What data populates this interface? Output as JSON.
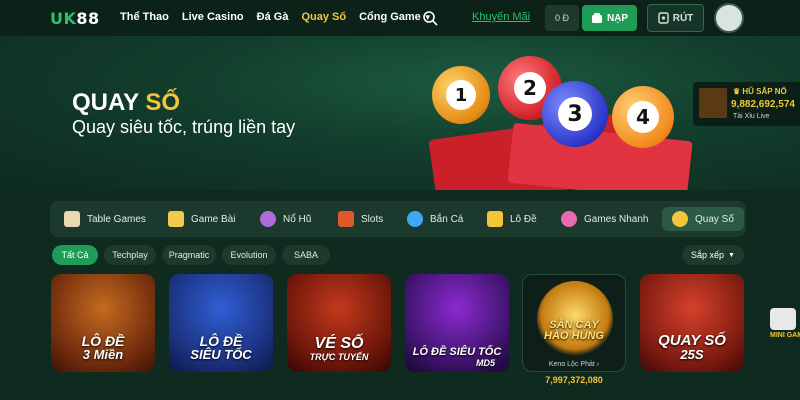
{
  "brand": {
    "logo_a": "UK",
    "logo_b": "88"
  },
  "nav": {
    "items": [
      "Thể Thao",
      "Live Casino",
      "Đá Gà",
      "Quay Số",
      "Cổng Game"
    ],
    "active": "Quay Số"
  },
  "header": {
    "promo": "Khuyến Mãi",
    "balance": "0 Đ",
    "deposit_label": "NẠP",
    "withdraw_label": "RÚT"
  },
  "banner": {
    "title_white": "QUAY",
    "title_yellow": "SỐ",
    "subtitle": "Quay siêu tốc, trúng liền tay",
    "balls": [
      "1",
      "2",
      "3",
      "4"
    ]
  },
  "jackpot": {
    "title": "HŨ SẮP NỔ",
    "value": "9,882,692,574",
    "game": "Tài Xỉu Live"
  },
  "categories": [
    {
      "label": "Table Games",
      "icon": "dice-icon"
    },
    {
      "label": "Game Bài",
      "icon": "cards-icon"
    },
    {
      "label": "Nổ Hũ",
      "icon": "pot-icon"
    },
    {
      "label": "Slots",
      "icon": "seven-icon"
    },
    {
      "label": "Bắn Cá",
      "icon": "fish-icon"
    },
    {
      "label": "Lô Đề",
      "icon": "ticket-icon"
    },
    {
      "label": "Games Nhanh",
      "icon": "rocket-icon"
    },
    {
      "label": "Quay Số",
      "icon": "lottery-ball-icon"
    }
  ],
  "filters": [
    "Tất Cả",
    "Techplay",
    "Pragmatic",
    "Evolution",
    "SABA"
  ],
  "sort_label": "Sắp xếp",
  "games": [
    {
      "line1": "LÔ ĐỀ",
      "line2": "3 Miền"
    },
    {
      "line1": "LÔ ĐỀ",
      "line2": "SIÊU TỐC"
    },
    {
      "line1": "VÉ SỐ",
      "line2": "TRỰC TUYẾN"
    },
    {
      "line1": "LÔ ĐỀ SIÊU TỐC",
      "line2": "MD5"
    },
    {
      "line1": "SĂN CÁY",
      "line2": "HÀO HÙNG"
    },
    {
      "line1": "QUAY SỐ",
      "line2": "25S"
    }
  ],
  "keno": {
    "caption": "Keno Lộc Phát",
    "value": "7,997,372,080"
  },
  "side_game_label": "MINI GAME",
  "colors": {
    "accent": "#27c26b",
    "gold": "#f4c43a",
    "bg": "#0f2a1f"
  }
}
